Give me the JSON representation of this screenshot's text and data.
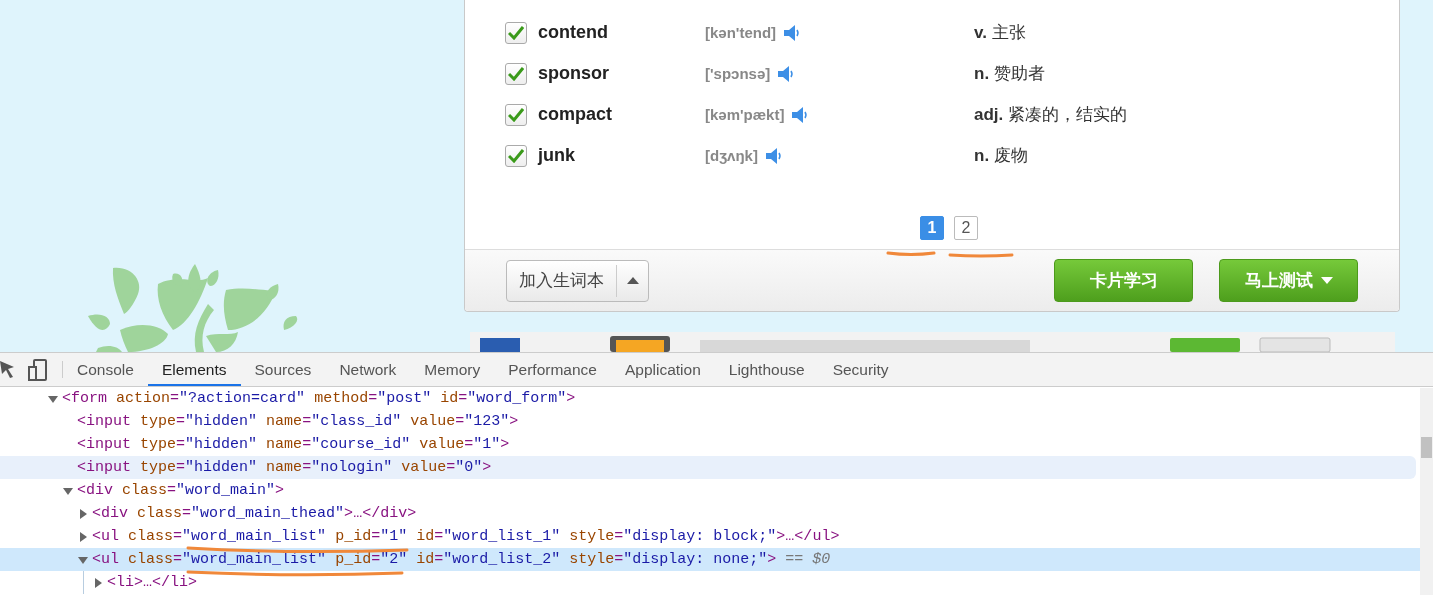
{
  "word_list": {
    "rows": [
      {
        "word": "contend",
        "phonetic": "[kən'tend]",
        "meaning": "**v.** 主张",
        "checked": true
      },
      {
        "word": "sponsor",
        "phonetic": "['spɔnsə]",
        "meaning": "**n.** 赞助者",
        "checked": true
      },
      {
        "word": "compact",
        "phonetic": "[kəm'pækt]",
        "meaning": "**adj.** 紧凑的，结实的",
        "checked": true
      },
      {
        "word": "junk",
        "phonetic": "[dʒʌŋk]",
        "meaning": "**n.** 废物",
        "checked": true
      }
    ]
  },
  "pagination": [
    {
      "label": "1",
      "selected": true
    },
    {
      "label": "2",
      "selected": false
    }
  ],
  "footer": {
    "add_button": "加入生词本",
    "buttons": [
      {
        "label": "卡片学习",
        "kind": "plain"
      },
      {
        "label": "马上测试",
        "kind": "dropdown"
      }
    ]
  },
  "devtools": {
    "tabs": [
      {
        "label": "Console",
        "selected": false
      },
      {
        "label": "Elements",
        "selected": true
      },
      {
        "label": "Sources",
        "selected": false
      },
      {
        "label": "Network",
        "selected": false
      },
      {
        "label": "Memory",
        "selected": false
      },
      {
        "label": "Performance",
        "selected": false
      },
      {
        "label": "Application",
        "selected": false
      },
      {
        "label": "Lighthouse",
        "selected": false
      },
      {
        "label": "Security",
        "selected": false
      }
    ],
    "dom_tree": [
      {
        "kind": "parent",
        "text": "<form action=\"?action=card\" method=\"post\" id=\"word_form\">",
        "expanded": true,
        "selected": false,
        "hovered": false,
        "children": [
          {
            "kind": "leaf",
            "text": "<input type=\"hidden\" name=\"class_id\" value=\"123\">",
            "selected": false,
            "hovered": false
          },
          {
            "kind": "leaf",
            "text": "<input type=\"hidden\" name=\"course_id\" value=\"1\">",
            "selected": false,
            "hovered": false
          },
          {
            "kind": "leaf",
            "text": "<input type=\"hidden\" name=\"nologin\" value=\"0\">",
            "selected": false,
            "hovered": true
          },
          {
            "kind": "parent",
            "text": "<div class=\"word_main\">",
            "expanded": true,
            "selected": false,
            "hovered": false,
            "children": [
              {
                "kind": "parent",
                "text": "<div class=\"word_main_thead\">…</div>",
                "expanded": false,
                "selected": false,
                "hovered": false
              },
              {
                "kind": "parent",
                "text": "<ul class=\"word_main_list\" p_id=\"1\" id=\"word_list_1\" style=\"display: block;\">…</ul>",
                "expanded": false,
                "selected": false,
                "hovered": false
              },
              {
                "kind": "parent",
                "text": "<ul class=\"word_main_list\" p_id=\"2\" id=\"word_list_2\" style=\"display: none;\">",
                "suffix": "== $0",
                "expanded": true,
                "selected": true,
                "hovered": false,
                "children": [
                  {
                    "kind": "parent",
                    "text": "<li>…</li>",
                    "expanded": false,
                    "selected": false,
                    "hovered": false
                  }
                ]
              }
            ]
          }
        ]
      }
    ]
  }
}
